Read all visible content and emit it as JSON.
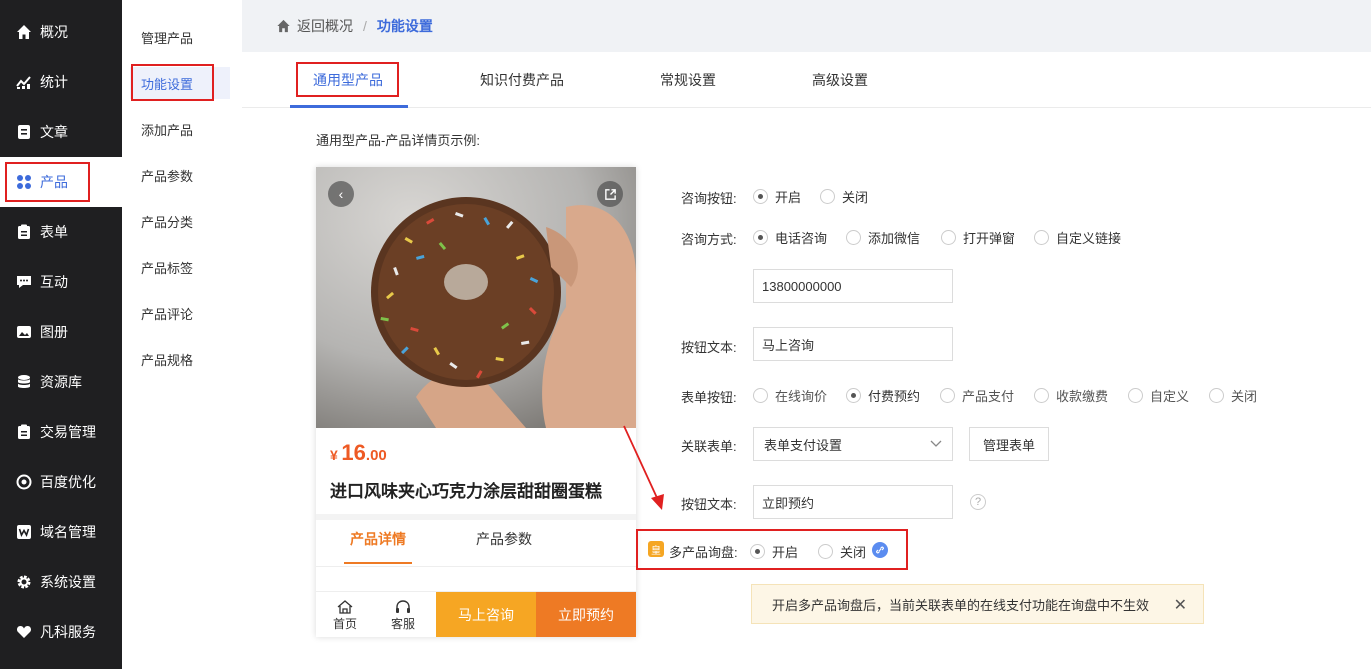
{
  "sidebar": {
    "items": [
      {
        "label": "概况",
        "icon": "home-icon"
      },
      {
        "label": "统计",
        "icon": "chart-icon"
      },
      {
        "label": "文章",
        "icon": "article-icon"
      },
      {
        "label": "产品",
        "icon": "grid-icon"
      },
      {
        "label": "表单",
        "icon": "clipboard-icon"
      },
      {
        "label": "互动",
        "icon": "chat-icon"
      },
      {
        "label": "图册",
        "icon": "image-icon"
      },
      {
        "label": "资源库",
        "icon": "database-icon"
      },
      {
        "label": "交易管理",
        "icon": "clipboard-icon"
      },
      {
        "label": "百度优化",
        "icon": "target-icon"
      },
      {
        "label": "域名管理",
        "icon": "w-icon"
      },
      {
        "label": "系统设置",
        "icon": "gear-icon"
      },
      {
        "label": "凡科服务",
        "icon": "heart-icon"
      }
    ]
  },
  "subnav": {
    "items": [
      "管理产品",
      "功能设置",
      "添加产品",
      "产品参数",
      "产品分类",
      "产品标签",
      "产品评论",
      "产品规格"
    ]
  },
  "breadcrumb": {
    "back": "返回概况",
    "sep": "/",
    "current": "功能设置"
  },
  "tabs": [
    "通用型产品",
    "知识付费产品",
    "常规设置",
    "高级设置"
  ],
  "section_title": "通用型产品-产品详情页示例:",
  "phone": {
    "price_symbol": "¥",
    "price_int": "16",
    "price_dec": ".00",
    "product_name": "进口风味夹心巧克力涂层甜甜圈蛋糕",
    "tabs": [
      "产品详情",
      "产品参数"
    ],
    "bottom": {
      "home": "首页",
      "service": "客服",
      "consult": "马上咨询",
      "book": "立即预约"
    }
  },
  "form": {
    "consult_button": {
      "label": "咨询按钮:",
      "options": [
        "开启",
        "关闭"
      ],
      "selected": 0
    },
    "consult_method": {
      "label": "咨询方式:",
      "options": [
        "电话咨询",
        "添加微信",
        "打开弹窗",
        "自定义链接"
      ],
      "selected": 0
    },
    "phone_value": "13800000000",
    "button_text1": {
      "label": "按钮文本:",
      "value": "马上咨询"
    },
    "form_button": {
      "label": "表单按钮:",
      "options": [
        "在线询价",
        "付费预约",
        "产品支付",
        "收款缴费",
        "自定义",
        "关闭"
      ],
      "selected": 1
    },
    "linked_form": {
      "label": "关联表单:",
      "value": "表单支付设置",
      "manage": "管理表单"
    },
    "button_text2": {
      "label": "按钮文本:",
      "value": "立即预约"
    },
    "multi_inquiry": {
      "badge": "皇",
      "label": "多产品询盘:",
      "options": [
        "开启",
        "关闭"
      ],
      "selected": 0
    }
  },
  "notice": {
    "text": "开启多产品询盘后，当前关联表单的在线支付功能在询盘中不生效",
    "close": "✕"
  },
  "help_mark": "?"
}
